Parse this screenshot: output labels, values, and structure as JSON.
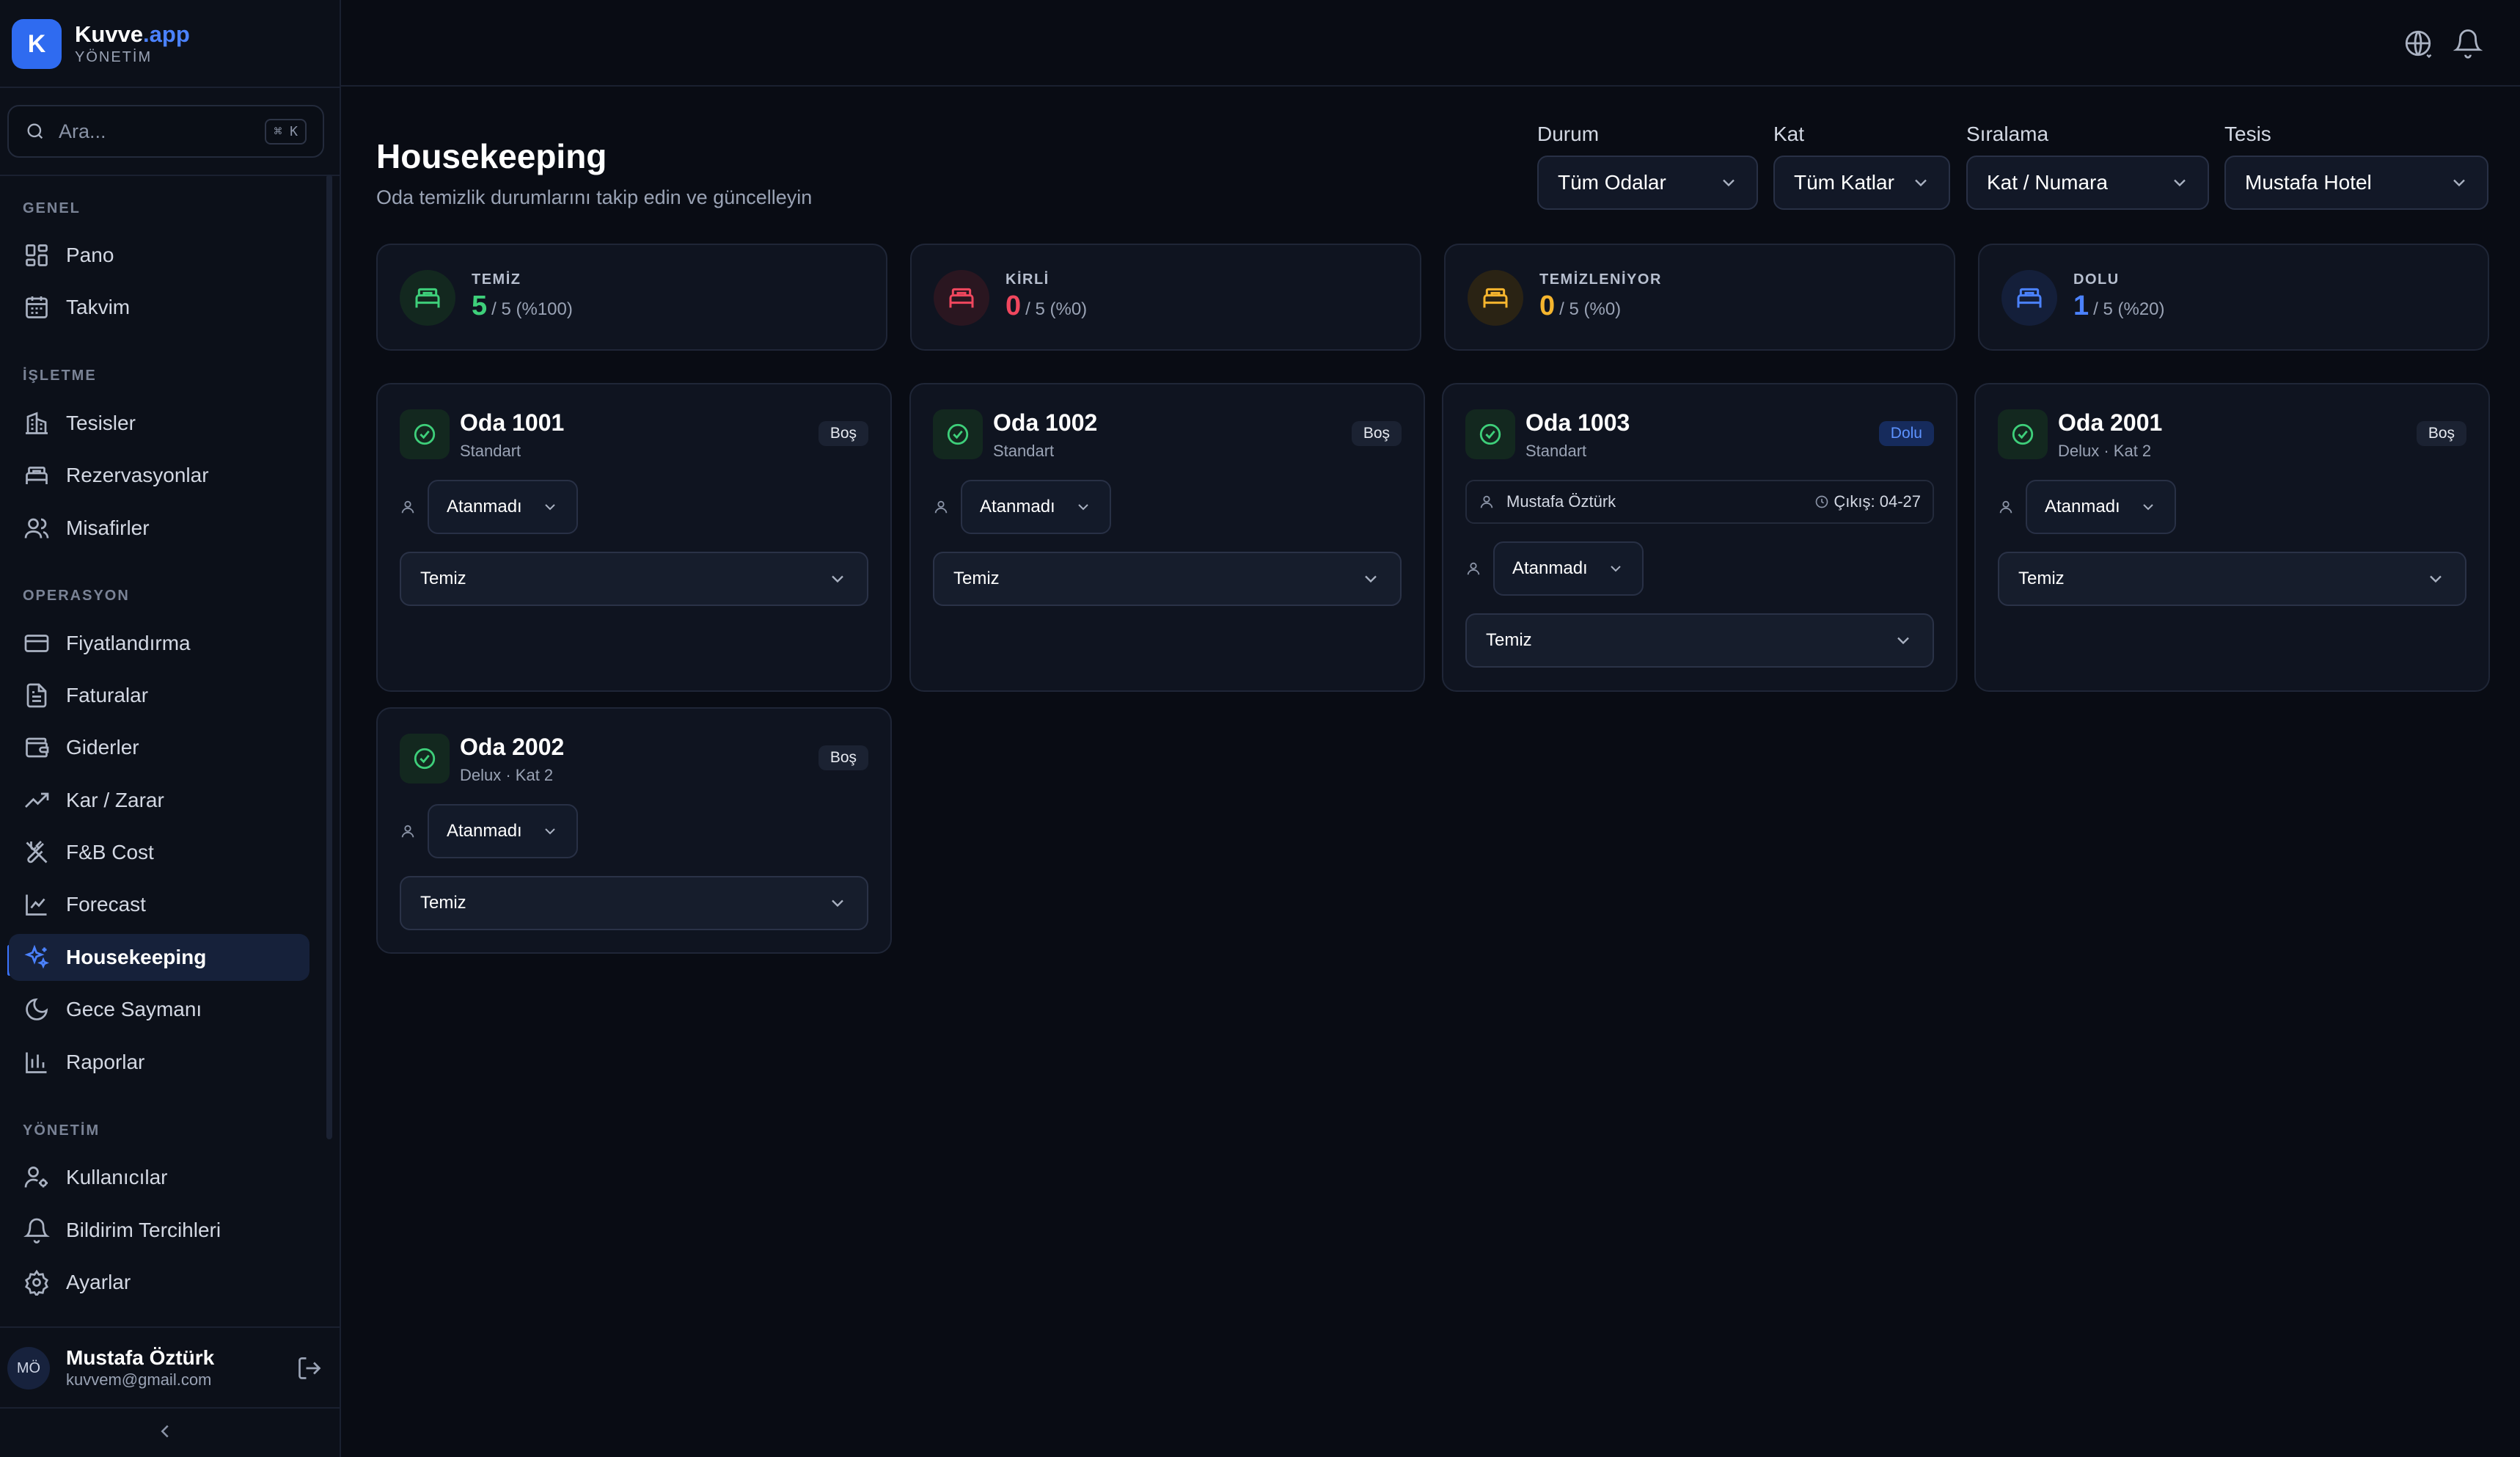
{
  "brand": {
    "logo_letter": "K",
    "name": "Kuvve",
    "name_suffix": ".app",
    "subtitle": "YÖNETİM"
  },
  "search": {
    "placeholder": "Ara...",
    "shortcut": "⌘ K"
  },
  "nav": {
    "sections": [
      {
        "title": "GENEL",
        "items": [
          {
            "label": "Pano",
            "icon": "grid-icon"
          },
          {
            "label": "Takvim",
            "icon": "calendar-icon"
          }
        ]
      },
      {
        "title": "İŞLETME",
        "items": [
          {
            "label": "Tesisler",
            "icon": "building-icon"
          },
          {
            "label": "Rezervasyonlar",
            "icon": "bed-icon"
          },
          {
            "label": "Misafirler",
            "icon": "users-icon"
          }
        ]
      },
      {
        "title": "OPERASYON",
        "items": [
          {
            "label": "Fiyatlandırma",
            "icon": "credit-card-icon"
          },
          {
            "label": "Faturalar",
            "icon": "file-text-icon"
          },
          {
            "label": "Giderler",
            "icon": "wallet-icon"
          },
          {
            "label": "Kar / Zarar",
            "icon": "trending-up-icon"
          },
          {
            "label": "F&B Cost",
            "icon": "utensils-icon"
          },
          {
            "label": "Forecast",
            "icon": "line-chart-icon"
          },
          {
            "label": "Housekeeping",
            "icon": "sparkles-icon",
            "active": true
          },
          {
            "label": "Gece Saymanı",
            "icon": "moon-icon"
          },
          {
            "label": "Raporlar",
            "icon": "bar-chart-icon"
          }
        ]
      },
      {
        "title": "YÖNETİM",
        "items": [
          {
            "label": "Kullanıcılar",
            "icon": "user-cog-icon"
          },
          {
            "label": "Bildirim Tercihleri",
            "icon": "bell-icon"
          },
          {
            "label": "Ayarlar",
            "icon": "settings-icon"
          }
        ]
      }
    ]
  },
  "user": {
    "initials": "MÖ",
    "name": "Mustafa Öztürk",
    "email": "kuvvem@gmail.com"
  },
  "page": {
    "title": "Housekeeping",
    "subtitle": "Oda temizlik durumlarını takip edin ve güncelleyin"
  },
  "filters": {
    "status": {
      "label": "Durum",
      "value": "Tüm Odalar"
    },
    "floor": {
      "label": "Kat",
      "value": "Tüm Katlar"
    },
    "sort": {
      "label": "Sıralama",
      "value": "Kat / Numara"
    },
    "property": {
      "label": "Tesis",
      "value": "Mustafa Hotel"
    }
  },
  "stats": [
    {
      "label": "TEMİZ",
      "value": "5",
      "rest": "/ 5 (%100)",
      "color": "#3ecf7a"
    },
    {
      "label": "KİRLİ",
      "value": "0",
      "rest": "/ 5 (%0)",
      "color": "#f0475e"
    },
    {
      "label": "TEMİZLENİYOR",
      "value": "0",
      "rest": "/ 5 (%0)",
      "color": "#f5b52e"
    },
    {
      "label": "DOLU",
      "value": "1",
      "rest": "/ 5 (%20)",
      "color": "#4b82ff"
    }
  ],
  "rooms": [
    {
      "name": "Oda 1001",
      "type": "Standart",
      "badge": "Boş",
      "assignee": "Atanmadı",
      "status": "Temiz"
    },
    {
      "name": "Oda 1002",
      "type": "Standart",
      "badge": "Boş",
      "assignee": "Atanmadı",
      "status": "Temiz"
    },
    {
      "name": "Oda 1003",
      "type": "Standart",
      "badge": "Dolu",
      "guest": "Mustafa Öztürk",
      "checkout": "Çıkış: 04-27",
      "assignee": "Atanmadı",
      "status": "Temiz"
    },
    {
      "name": "Oda 2001",
      "type": "Delux · Kat 2",
      "badge": "Boş",
      "assignee": "Atanmadı",
      "status": "Temiz"
    },
    {
      "name": "Oda 2002",
      "type": "Delux · Kat 2",
      "badge": "Boş",
      "assignee": "Atanmadı",
      "status": "Temiz"
    }
  ],
  "topbar": {
    "icons": [
      "globe-icon",
      "bell-icon"
    ]
  }
}
